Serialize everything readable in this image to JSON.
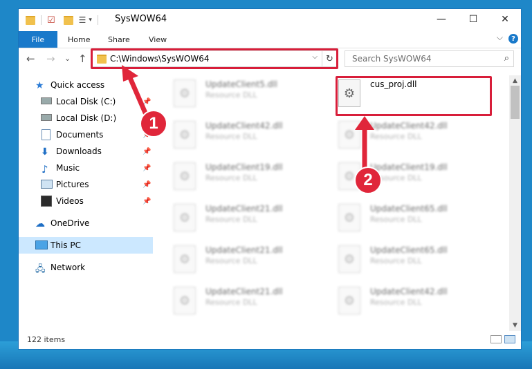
{
  "window": {
    "title": "SysWOW64",
    "minimize_glyph": "—",
    "maximize_glyph": "☐",
    "close_glyph": "✕"
  },
  "ribbon": {
    "file": "File",
    "tabs": [
      "Home",
      "Share",
      "View"
    ],
    "help_glyph": "?",
    "collapse_glyph": "⌵"
  },
  "nav": {
    "back": "←",
    "forward": "→",
    "recent": "⌄",
    "up": "↑",
    "address": "C:\\Windows\\SysWOW64",
    "address_drop": "⌵",
    "refresh": "↻",
    "search_placeholder": "Search SysWOW64",
    "search_glyph": "⌕"
  },
  "sidebar": {
    "items": [
      {
        "label": "Quick access",
        "icon": "star-icon",
        "pinned": false
      },
      {
        "label": "Local Disk (C:)",
        "icon": "drive-icon",
        "pinned": true
      },
      {
        "label": "Local Disk (D:)",
        "icon": "drive-icon",
        "pinned": false
      },
      {
        "label": "Documents",
        "icon": "document-icon",
        "pinned": true
      },
      {
        "label": "Downloads",
        "icon": "download-icon",
        "pinned": true
      },
      {
        "label": "Music",
        "icon": "music-icon",
        "pinned": true
      },
      {
        "label": "Pictures",
        "icon": "picture-icon",
        "pinned": true
      },
      {
        "label": "Videos",
        "icon": "video-icon",
        "pinned": true
      },
      {
        "label": "OneDrive",
        "icon": "cloud-icon",
        "pinned": false
      },
      {
        "label": "This PC",
        "icon": "computer-icon",
        "pinned": false,
        "selected": true
      },
      {
        "label": "Network",
        "icon": "network-icon",
        "pinned": false
      }
    ]
  },
  "files": {
    "highlight": {
      "name": "cus_proj.dll",
      "desc": ""
    },
    "left": [
      {
        "name": "UpdateClient5.dll",
        "desc": "Resource DLL"
      },
      {
        "name": "UpdateClient42.dll",
        "desc": "Resource DLL"
      },
      {
        "name": "UpdateClient19.dll",
        "desc": "Resource DLL"
      },
      {
        "name": "UpdateClient21.dll",
        "desc": "Resource DLL"
      },
      {
        "name": "UpdateClient21.dll",
        "desc": "Resource DLL"
      },
      {
        "name": "UpdateClient21.dll",
        "desc": "Resource DLL"
      }
    ],
    "right": [
      {
        "name": "UpdateClient42.dll",
        "desc": "Resource DLL"
      },
      {
        "name": "UpdateClient19.dll",
        "desc": "Resource DLL"
      },
      {
        "name": "UpdateClient65.dll",
        "desc": "Resource DLL"
      },
      {
        "name": "UpdateClient65.dll",
        "desc": "Resource DLL"
      },
      {
        "name": "UpdateClient42.dll",
        "desc": "Resource DLL"
      }
    ]
  },
  "status": {
    "count": "122 items"
  },
  "callouts": {
    "one": "1",
    "two": "2"
  },
  "colors": {
    "accent": "#1979ca",
    "highlight_red": "#d81e3a",
    "selected": "#cce8ff"
  }
}
